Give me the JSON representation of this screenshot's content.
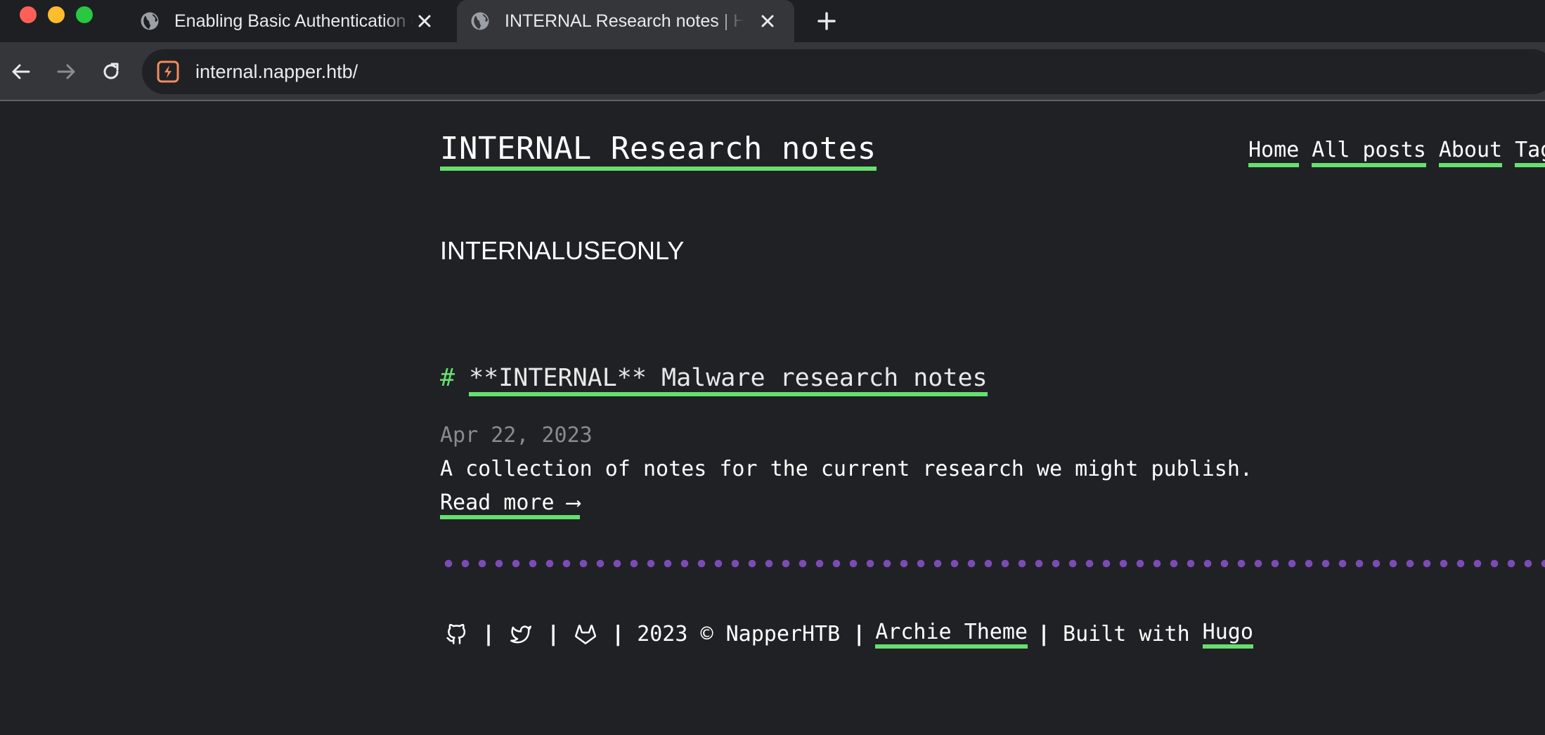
{
  "browser": {
    "tabs": [
      {
        "title": "Enabling Basic Authentication on",
        "active": false
      },
      {
        "title": "INTERNAL Research notes | Hom",
        "active": true
      }
    ],
    "url": "internal.napper.htb/"
  },
  "site": {
    "title": "INTERNAL Research notes",
    "nav": [
      "Home",
      "All posts",
      "About",
      "Tags"
    ],
    "tagline": "INTERNALUSEONLY"
  },
  "post": {
    "hash": "#",
    "title": "**INTERNAL** Malware research notes",
    "date": "Apr 22, 2023",
    "summary": "A collection of notes for the current research we might publish.",
    "read_more": "Read more ⟶"
  },
  "footer": {
    "icons": [
      "github-icon",
      "twitter-icon",
      "gitlab-icon"
    ],
    "separator": "|",
    "copyright": "2023 © NapperHTB",
    "theme_link": "Archie Theme",
    "built_with": "Built with",
    "hugo_link": "Hugo"
  },
  "colors": {
    "background": "#202124",
    "accent_underline": "#65e06f",
    "divider_dots": "#7b4bb8",
    "date_text": "#8b8b8b"
  }
}
